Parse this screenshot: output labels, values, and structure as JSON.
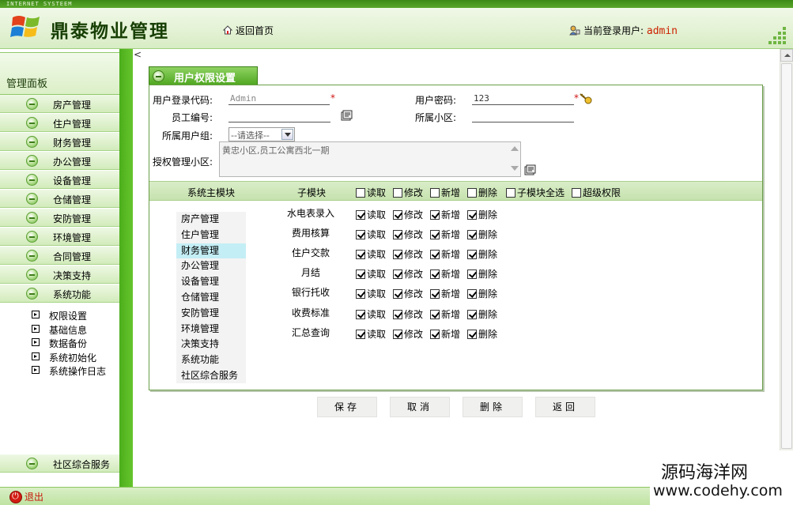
{
  "header": {
    "banner_text": "INTERNET SYSTEEM",
    "app_title": "鼎泰物业管理",
    "home_link": "返回首页",
    "user_label": "当前登录用户:",
    "user_name": "admin"
  },
  "sidebar": {
    "title": "管理面板",
    "items": [
      "房产管理",
      "住户管理",
      "财务管理",
      "办公管理",
      "设备管理",
      "仓储管理",
      "安防管理",
      "环境管理",
      "合同管理",
      "决策支持",
      "系统功能"
    ],
    "sub_items": [
      "权限设置",
      "基础信息",
      "数据备份",
      "系统初始化",
      "系统操作日志"
    ],
    "bottom_item": "社区综合服务"
  },
  "footer": {
    "logout_label": "退出"
  },
  "main": {
    "collapse_arrow": "<",
    "tab_title": "用户权限设置",
    "form": {
      "login_code_label": "用户登录代码:",
      "login_code_value": "Admin",
      "password_label": "用户密码:",
      "password_value": "123",
      "employee_no_label": "员工编号:",
      "employee_no_value": "",
      "community_label": "所属小区:",
      "community_value": "",
      "group_label": "所属用户组:",
      "group_value": "--请选择--",
      "authorized_label": "授权管理小区:",
      "authorized_value": "黄忠小区,员工公寓西北一期",
      "required_mark": "*"
    },
    "perm_header": {
      "main_module": "系统主模块",
      "sub_module": "子模块",
      "read": "读取",
      "edit": "修改",
      "add": "新增",
      "delete": "删除",
      "select_all": "子模块全选",
      "super": "超级权限"
    },
    "modules": [
      "房产管理",
      "住户管理",
      "财务管理",
      "办公管理",
      "设备管理",
      "仓储管理",
      "安防管理",
      "环境管理",
      "决策支持",
      "系统功能",
      "社区综合服务"
    ],
    "selected_module": "财务管理",
    "sub_modules": [
      "水电表录入",
      "费用核算",
      "住户交款",
      "月结",
      "银行托收",
      "收费标准",
      "汇总查询"
    ],
    "buttons": {
      "save": "保存",
      "cancel": "取消",
      "delete": "删除",
      "back": "返回"
    }
  },
  "watermark": {
    "cn": "源码海洋网",
    "url": "www.codehy.com"
  },
  "colors": {
    "accent_green": "#4ea61f",
    "user_red": "#cc2200",
    "selected_row": "#c4eef5"
  }
}
